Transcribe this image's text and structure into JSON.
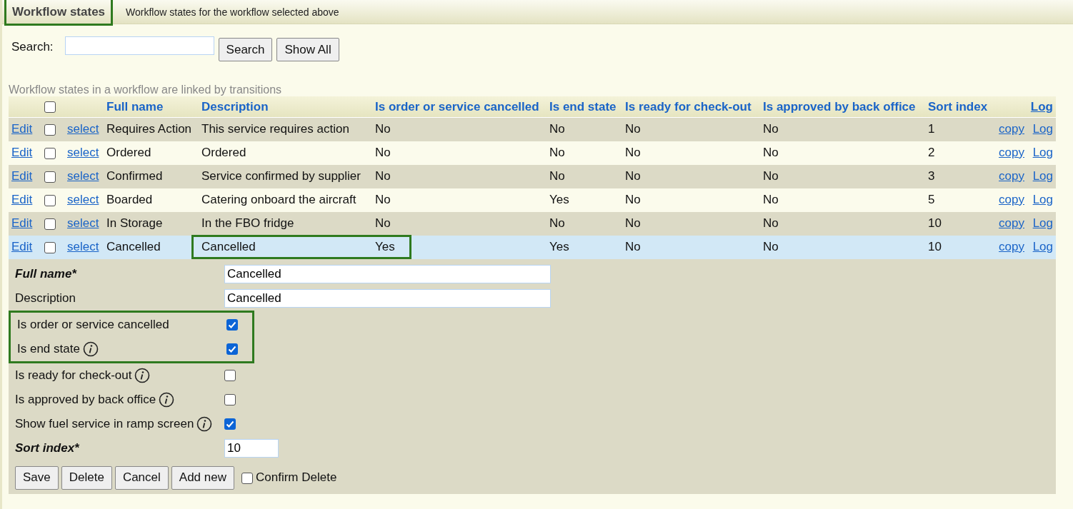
{
  "header": {
    "title": "Workflow states",
    "subtitle": "Workflow states for the workflow selected above",
    "title_highlighted": true
  },
  "search": {
    "label": "Search:",
    "buttons": [
      "Search",
      "Show All"
    ]
  },
  "caption": "Workflow states in a workflow are linked by transitions",
  "table": {
    "select_all_checked": false,
    "columns": [
      "Full name",
      "Description",
      "Is order or service cancelled",
      "Is end state",
      "Is ready for check-out",
      "Is approved by back office",
      "Sort index",
      "Log"
    ],
    "rows": [
      {
        "edit": "Edit",
        "checked": false,
        "select": "select",
        "selected": false,
        "cells": [
          "Requires Action",
          "This service requires action",
          "No",
          "No",
          "No",
          "No",
          "1"
        ],
        "copy": "copy",
        "log": "Log"
      },
      {
        "edit": "Edit",
        "checked": false,
        "select": "select",
        "selected": false,
        "cells": [
          "Ordered",
          "Ordered",
          "No",
          "No",
          "No",
          "No",
          "2"
        ],
        "copy": "copy",
        "log": "Log"
      },
      {
        "edit": "Edit",
        "checked": false,
        "select": "select",
        "selected": false,
        "cells": [
          "Confirmed",
          "Service confirmed by supplier",
          "No",
          "No",
          "No",
          "No",
          "3"
        ],
        "copy": "copy",
        "log": "Log"
      },
      {
        "edit": "Edit",
        "checked": false,
        "select": "select",
        "selected": false,
        "cells": [
          "Boarded",
          "Catering onboard the aircraft",
          "No",
          "Yes",
          "No",
          "No",
          "5"
        ],
        "copy": "copy",
        "log": "Log"
      },
      {
        "edit": "Edit",
        "checked": false,
        "select": "select",
        "selected": false,
        "cells": [
          "In Storage",
          "In the FBO fridge",
          "No",
          "No",
          "No",
          "No",
          "10"
        ],
        "copy": "copy",
        "log": "Log"
      },
      {
        "edit": "Edit",
        "checked": false,
        "select": "select",
        "selected": true,
        "highlighted": true,
        "cells": [
          "Cancelled",
          "Cancelled",
          "Yes",
          "Yes",
          "No",
          "No",
          "10"
        ],
        "copy": "copy",
        "log": "Log"
      }
    ]
  },
  "form": {
    "fields": [
      {
        "kind": "text",
        "label": "Full name*",
        "required": true,
        "value": "Cancelled",
        "highlighted": false
      },
      {
        "kind": "text",
        "label": "Description",
        "required": false,
        "value": "Cancelled",
        "highlighted": false
      },
      {
        "kind": "checkbox",
        "label": "Is order or service cancelled",
        "info": false,
        "checked": true,
        "highlighted": true
      },
      {
        "kind": "checkbox",
        "label": "Is end state",
        "info": true,
        "checked": true,
        "highlighted": true
      },
      {
        "kind": "checkbox",
        "label": "Is ready for check-out",
        "info": true,
        "checked": false,
        "highlighted": false
      },
      {
        "kind": "checkbox",
        "label": "Is approved by back office",
        "info": true,
        "checked": false,
        "highlighted": false
      },
      {
        "kind": "checkbox",
        "label": "Show fuel service in ramp screen",
        "info": true,
        "checked": true,
        "highlighted": false
      },
      {
        "kind": "short",
        "label": "Sort index*",
        "required": true,
        "value": "10",
        "highlighted": false
      }
    ],
    "buttons": [
      "Save",
      "Delete",
      "Cancel",
      "Add new"
    ],
    "confirm_delete": {
      "label": "Confirm Delete",
      "checked": false
    }
  }
}
